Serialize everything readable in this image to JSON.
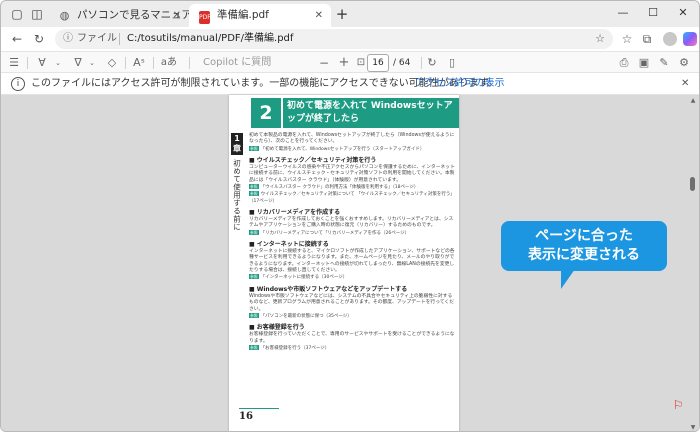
{
  "tabs": [
    {
      "title": "パソコンで見るマニュアル",
      "icon": "globe-icon",
      "active": false
    },
    {
      "title": "準備編.pdf",
      "icon": "pdf-icon",
      "badge": "PDF",
      "active": true
    }
  ],
  "addressbar": {
    "scheme": "ファイル",
    "url": "C:/tosutils/manual/PDF/準備編.pdf"
  },
  "pdf_toolbar": {
    "copilot_placeholder": "Copilot に質問",
    "zoom_out": "−",
    "zoom_in": "+",
    "read_aloud": "A",
    "translate": "aあ",
    "current_page": "16",
    "total_pages": "/ 64"
  },
  "infobar": {
    "message": "このファイルにはアクセス許可が制限されています。一部の機能にアクセスできない可能性があります。",
    "link": "アクセス許可の表示"
  },
  "page": {
    "section_number": "2",
    "section_title": "初めて電源を入れて Windowsセットアップが終了したら",
    "chapter_number": "1章",
    "chapter_title": "初めて使用する前に",
    "intro": "初めて本製品の電源を入れて、Windowsセットアップが終了したら（Windowsが使えるようになったら）、次のことを行ってください。",
    "intro_ref": "「初めて電源を入れて、Windowsセットアップを行う（スタートアップガイド）",
    "sections": [
      {
        "heading": "■ ウイルスチェック／セキュリティ対策を行う",
        "body": "コンピューターウイルスの感染や不正アクセスからパソコンを保護するために、インターネットに接続する前に、ウイルスチェック・セキュリティ対策ソフトの利用を開始してください。本製品には「ウイルスバスター クラウド」（体験版）が用意されています。",
        "refs": [
          "「ウイルスバスター クラウド」の利用方法「体験版を利用する」（18ページ）",
          "ウイルスチェック／セキュリティ対策について 「ウイルスチェック／セキュリティ対策を行う」（17ページ）"
        ]
      },
      {
        "heading": "■ リカバリーメディアを作成する",
        "body": "リカバリーメディアを作成しておくことを強くおすすめします。リカバリーメディアとは、システムやアプリケーションをご購入時の状態に復元（リカバリー）するためのものです。",
        "refs": [
          "「リカバリーメディアについて「リカバリーメディアを作る（26ページ）"
        ]
      },
      {
        "heading": "■ インターネットに接続する",
        "body": "インターネットに接続すると、マイクロソフトが作成したアプリケーション、サポートなどの各種サービスを利用できるようになります。また、ホームページを見たり、メールのやり取りができるようになります。インターネットへの接続が切れてしまったり、無線LANの接続先を変更したりする場合は、接続し直してください。",
        "refs": [
          "「インターネットに接続する（30ページ）"
        ]
      },
      {
        "heading": "■ Windowsや市販ソフトウェアなどをアップデートする",
        "body": "Windowsや市販ソフトウェアなどには、システムの不具合やセキュリティ上の脆弱性に対するものなど、更新プログラムが用意されることがあります。その都度、アップデートを行ってください。",
        "refs": [
          "「パソコンを最新の状態に保つ（35ページ）"
        ]
      },
      {
        "heading": "■ お客様登録を行う",
        "body": "お客様登録を行っていただくことで、専用のサービスやサポートを受けることができるようになります。",
        "refs": [
          "「お客様登録を行う（37ページ）"
        ]
      }
    ],
    "ref_tag": "参照",
    "page_number": "16"
  },
  "callout": {
    "line1": "ページに合った",
    "line2": "表示に変更される"
  },
  "colors": {
    "accent": "#1e9b83",
    "callout": "#1c96e0",
    "link": "#1a6bd1"
  }
}
